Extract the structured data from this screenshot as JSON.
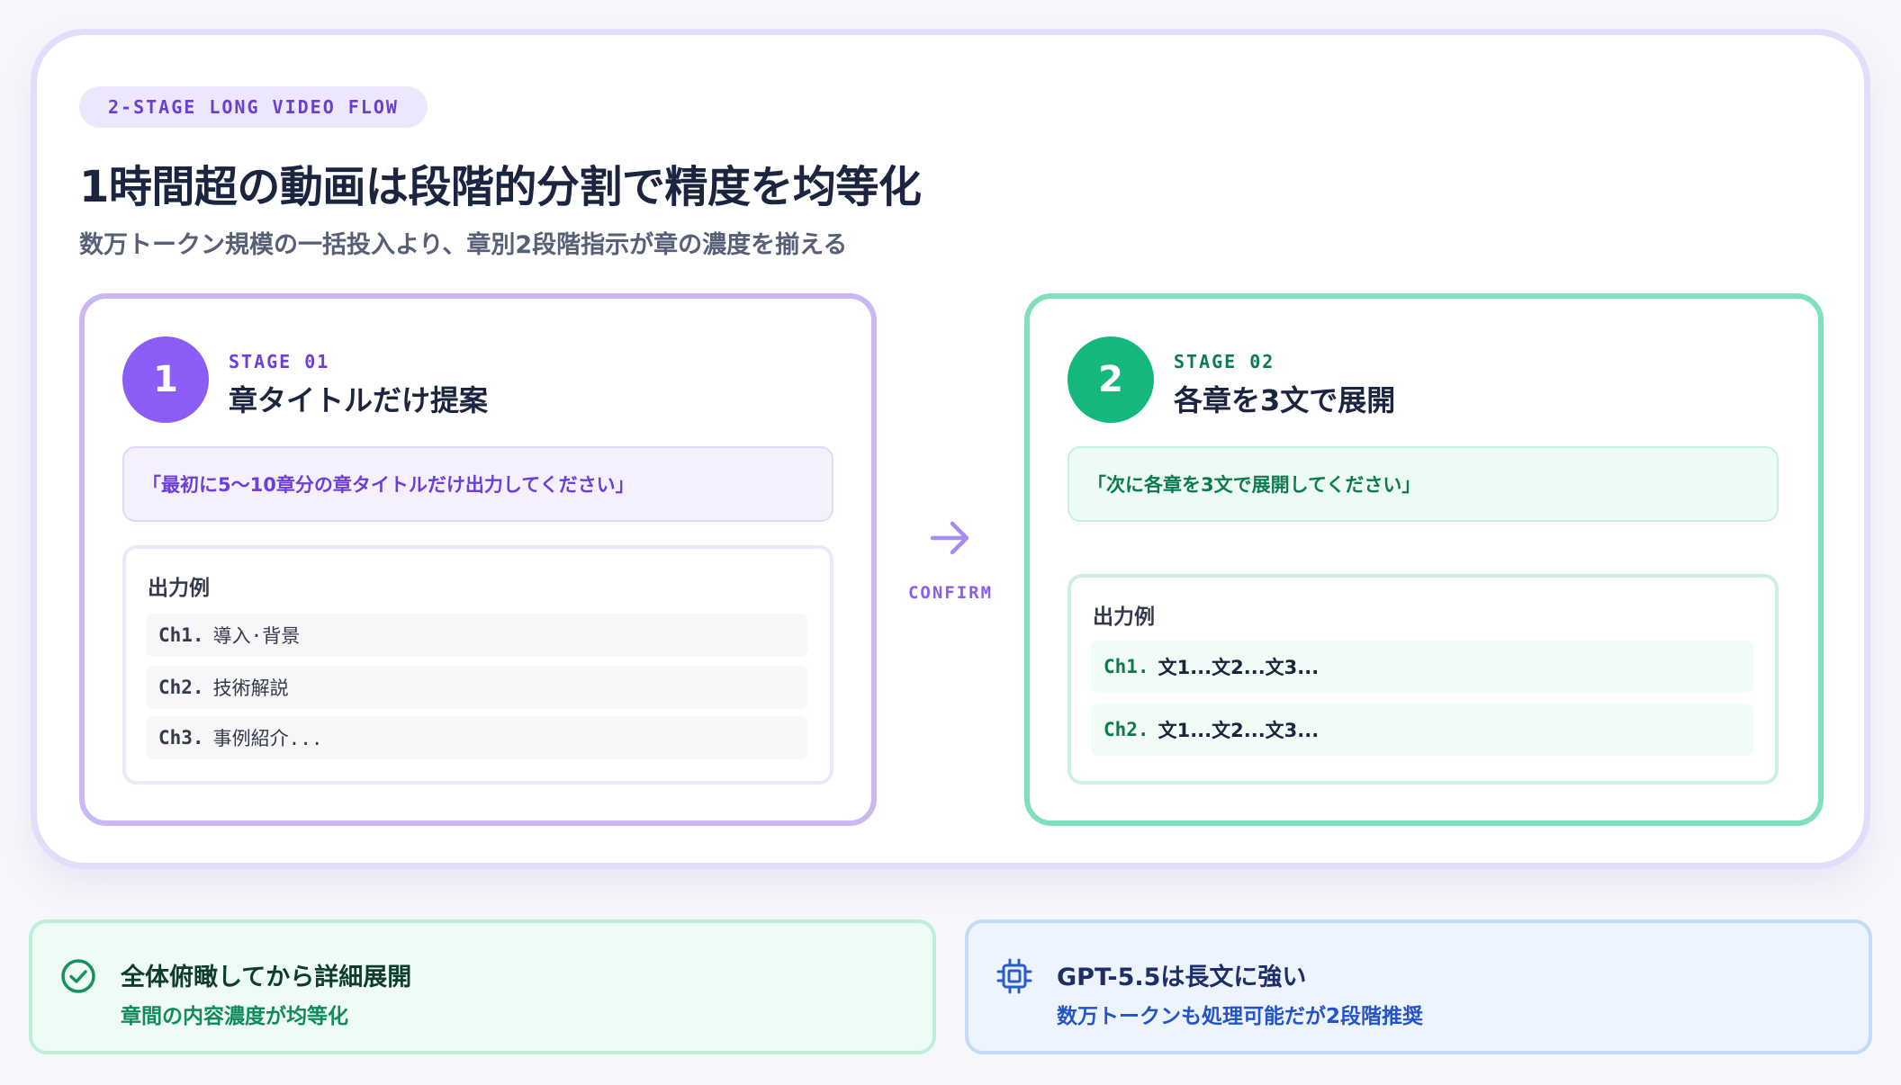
{
  "header": {
    "badge": "2-STAGE LONG VIDEO FLOW",
    "title": "1時間超の動画は段階的分割で精度を均等化",
    "subtitle": "数万トークン規模の一括投入より、章別2段階指示が章の濃度を揃える"
  },
  "stage1": {
    "number": "1",
    "label": "STAGE 01",
    "heading": "章タイトルだけ提案",
    "prompt": "「最初に5〜10章分の章タイトルだけ出力してください」",
    "output_title": "出力例",
    "rows": [
      {
        "ch": "Ch1.",
        "text": "導入·背景"
      },
      {
        "ch": "Ch2.",
        "text": "技術解説"
      },
      {
        "ch": "Ch3.",
        "text": "事例紹介..."
      }
    ]
  },
  "connector": {
    "icon": "arrow-right-icon",
    "label": "CONFIRM"
  },
  "stage2": {
    "number": "2",
    "label": "STAGE 02",
    "heading": "各章を3文で展開",
    "prompt": "「次に各章を3文で展開してください」",
    "output_title": "出力例",
    "rows": [
      {
        "ch": "Ch1.",
        "text": "文1...文2...文3..."
      },
      {
        "ch": "Ch2.",
        "text": "文1...文2...文3..."
      }
    ]
  },
  "notes": [
    {
      "icon": "check-circle-icon",
      "title": "全体俯瞰してから詳細展開",
      "desc": "章間の内容濃度が均等化"
    },
    {
      "icon": "chip-icon",
      "title": "GPT-5.5は長文に強い",
      "desc": "数万トークンも処理可能だが2段階推奨"
    }
  ],
  "colors": {
    "purple": "#8b5cf6",
    "green": "#14b87c",
    "blue": "#2454c8"
  }
}
